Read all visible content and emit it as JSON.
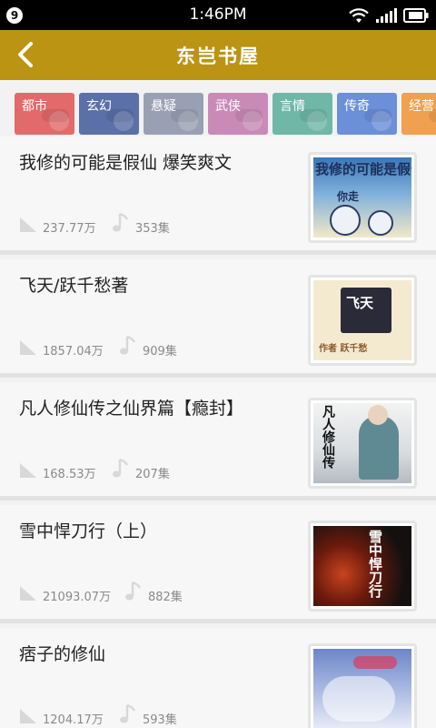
{
  "status_bar": {
    "badge": "9",
    "time": "1:46PM",
    "icons": [
      "wifi-icon",
      "signal-icon",
      "battery-icon"
    ]
  },
  "app_bar": {
    "title": "东岂书屋",
    "back_icon": "chevron-left-icon",
    "background_color": "#bb9413"
  },
  "categories": [
    {
      "label": "都市",
      "color": "#e26a6a"
    },
    {
      "label": "玄幻",
      "color": "#5b6fa8"
    },
    {
      "label": "悬疑",
      "color": "#9aa0b4"
    },
    {
      "label": "武侠",
      "color": "#c98ab8"
    },
    {
      "label": "言情",
      "color": "#6fb7a6"
    },
    {
      "label": "传奇",
      "color": "#6b8fd8"
    },
    {
      "label": "经营",
      "color": "#f0a04e"
    }
  ],
  "books": [
    {
      "title": "我修的可能是假仙 爆笑爽文",
      "plays": "237.77万",
      "episodes": "353集",
      "cover_text": "我修的可能是假仙",
      "cover_sub": "你走"
    },
    {
      "title": "飞天/跃千愁著",
      "plays": "1857.04万",
      "episodes": "909集",
      "cover_text": "飞天",
      "cover_sub": "作者 跃千愁"
    },
    {
      "title": "凡人修仙传之仙界篇【瘾封】",
      "plays": "168.53万",
      "episodes": "207集",
      "cover_text": "凡人修仙传",
      "cover_sub": ""
    },
    {
      "title": "雪中悍刀行（上）",
      "plays": "21093.07万",
      "episodes": "882集",
      "cover_text": "雪中悍刀行",
      "cover_sub": ""
    },
    {
      "title": "痞子的修仙",
      "plays": "1204.17万",
      "episodes": "593集",
      "cover_text": "",
      "cover_sub": ""
    }
  ]
}
